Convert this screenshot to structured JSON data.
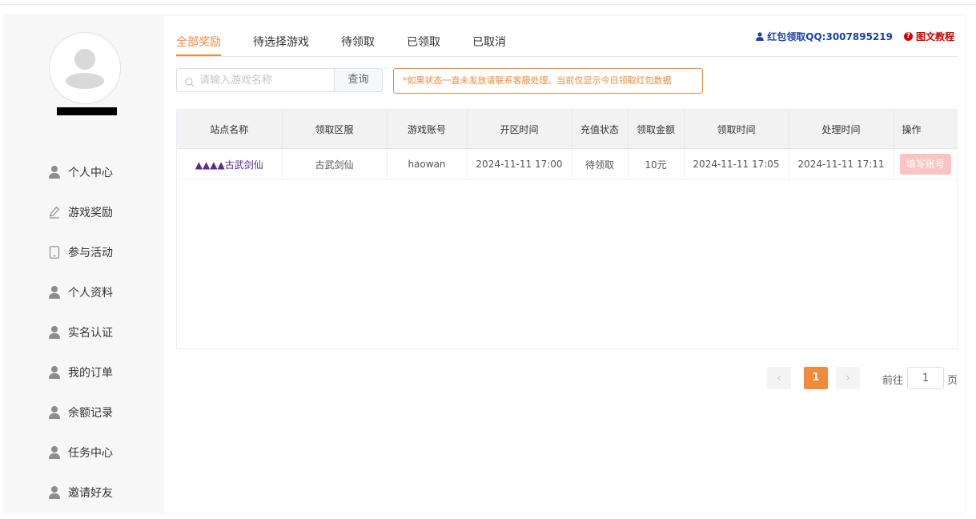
{
  "sidebar": {
    "items": [
      {
        "label": "个人中心",
        "icon": "user-icon"
      },
      {
        "label": "游戏奖励",
        "icon": "pencil-icon"
      },
      {
        "label": "参与活动",
        "icon": "tablet-icon"
      },
      {
        "label": "个人资料",
        "icon": "user-icon"
      },
      {
        "label": "实名认证",
        "icon": "user-icon"
      },
      {
        "label": "我的订单",
        "icon": "user-icon"
      },
      {
        "label": "余额记录",
        "icon": "user-icon"
      },
      {
        "label": "任务中心",
        "icon": "user-icon"
      },
      {
        "label": "邀请好友",
        "icon": "user-icon"
      }
    ]
  },
  "tabs": [
    {
      "label": "全部奖励",
      "active": true
    },
    {
      "label": "待选择游戏"
    },
    {
      "label": "待领取"
    },
    {
      "label": "已领取"
    },
    {
      "label": "已取消"
    }
  ],
  "header_links": {
    "qq_label": "红包领取QQ:3007895219",
    "tutorial_label": "图文教程"
  },
  "search": {
    "placeholder": "请输入游戏名称",
    "button_label": "查询"
  },
  "notice": "*如果状态一直未发放请联系客服处理。当前仅显示今日领取红包数据",
  "table": {
    "columns": [
      "站点名称",
      "领取区服",
      "游戏账号",
      "开区时间",
      "充值状态",
      "领取金额",
      "领取时间",
      "处理时间",
      "操作"
    ],
    "rows": [
      {
        "site": "▲▲▲▲古武剑仙",
        "server": "古武剑仙",
        "account": "haowan",
        "open_time": "2024-11-11 17:00",
        "status": "待领取",
        "amount": "10元",
        "claim_time": "2024-11-11 17:05",
        "process_time": "2024-11-11 17:11",
        "action": "填写账号"
      }
    ]
  },
  "pagination": {
    "prev": "‹",
    "current": "1",
    "next": "›",
    "goto_label": "前往",
    "goto_value": "1",
    "page_suffix": "页"
  },
  "colors": {
    "accent": "#f08a3c",
    "qq_link": "#1a3fa8",
    "tutorial_link": "#d40000",
    "action_disabled": "#fbc4c4"
  }
}
